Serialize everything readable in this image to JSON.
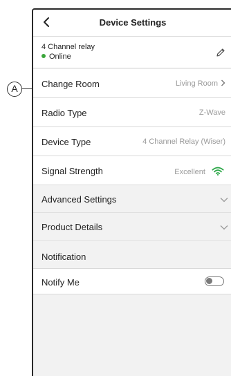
{
  "header": {
    "title": "Device Settings",
    "back_icon": "chevron-left-icon"
  },
  "device": {
    "name": "4 Channel relay",
    "status": "Online",
    "status_color": "#3aa63a",
    "edit_icon": "pencil-icon"
  },
  "rows": {
    "change_room": {
      "label": "Change Room",
      "value": "Living Room"
    },
    "radio_type": {
      "label": "Radio Type",
      "value": "Z-Wave"
    },
    "device_type": {
      "label": "Device Type",
      "value": "4 Channel Relay (Wiser)"
    },
    "signal_strength": {
      "label": "Signal Strength",
      "value": "Excellent",
      "icon": "wifi-icon",
      "icon_color": "#2ea84a"
    }
  },
  "sections": {
    "advanced": {
      "label": "Advanced Settings"
    },
    "product": {
      "label": "Product Details"
    },
    "notification": {
      "label": "Notification"
    }
  },
  "notify": {
    "label": "Notify Me",
    "enabled": false
  },
  "annotation": {
    "label": "A"
  }
}
